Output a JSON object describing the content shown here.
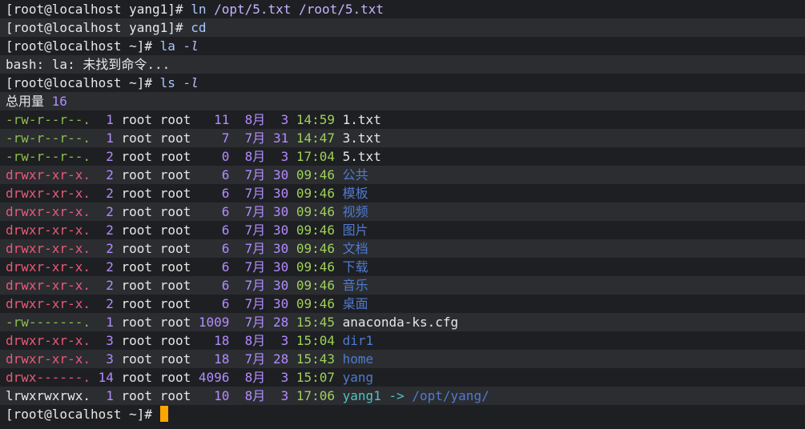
{
  "lines": [
    {
      "type": "cmd",
      "prompt": "[root@localhost yang1]#",
      "cmd": "ln",
      "args": " /opt/5.txt /root/5.txt",
      "flag": ""
    },
    {
      "type": "cmd",
      "prompt": "[root@localhost yang1]#",
      "cmd": "cd",
      "args": "",
      "flag": ""
    },
    {
      "type": "cmd",
      "prompt": "[root@localhost ~]#",
      "cmd": "la",
      "args": "",
      "flag": " -l"
    },
    {
      "type": "out",
      "text": "bash: la: 未找到命令..."
    },
    {
      "type": "cmd",
      "prompt": "[root@localhost ~]#",
      "cmd": "ls",
      "args": "",
      "flag": " -l"
    },
    {
      "type": "total",
      "label": "总用量",
      "value": "16"
    }
  ],
  "entries": [
    {
      "perm": "-rw-r--r--.",
      "links": "1",
      "owner": "root",
      "group": "root",
      "size": "11",
      "month": "8月",
      "day": "3",
      "time": "14:59",
      "name": "1.txt",
      "kind": "file"
    },
    {
      "perm": "-rw-r--r--.",
      "links": "1",
      "owner": "root",
      "group": "root",
      "size": "7",
      "month": "7月",
      "day": "31",
      "time": "14:47",
      "name": "3.txt",
      "kind": "file"
    },
    {
      "perm": "-rw-r--r--.",
      "links": "2",
      "owner": "root",
      "group": "root",
      "size": "0",
      "month": "8月",
      "day": "3",
      "time": "17:04",
      "name": "5.txt",
      "kind": "file"
    },
    {
      "perm": "drwxr-xr-x.",
      "links": "2",
      "owner": "root",
      "group": "root",
      "size": "6",
      "month": "7月",
      "day": "30",
      "time": "09:46",
      "name": "公共",
      "kind": "dir"
    },
    {
      "perm": "drwxr-xr-x.",
      "links": "2",
      "owner": "root",
      "group": "root",
      "size": "6",
      "month": "7月",
      "day": "30",
      "time": "09:46",
      "name": "模板",
      "kind": "dir"
    },
    {
      "perm": "drwxr-xr-x.",
      "links": "2",
      "owner": "root",
      "group": "root",
      "size": "6",
      "month": "7月",
      "day": "30",
      "time": "09:46",
      "name": "视频",
      "kind": "dir"
    },
    {
      "perm": "drwxr-xr-x.",
      "links": "2",
      "owner": "root",
      "group": "root",
      "size": "6",
      "month": "7月",
      "day": "30",
      "time": "09:46",
      "name": "图片",
      "kind": "dir"
    },
    {
      "perm": "drwxr-xr-x.",
      "links": "2",
      "owner": "root",
      "group": "root",
      "size": "6",
      "month": "7月",
      "day": "30",
      "time": "09:46",
      "name": "文档",
      "kind": "dir"
    },
    {
      "perm": "drwxr-xr-x.",
      "links": "2",
      "owner": "root",
      "group": "root",
      "size": "6",
      "month": "7月",
      "day": "30",
      "time": "09:46",
      "name": "下载",
      "kind": "dir"
    },
    {
      "perm": "drwxr-xr-x.",
      "links": "2",
      "owner": "root",
      "group": "root",
      "size": "6",
      "month": "7月",
      "day": "30",
      "time": "09:46",
      "name": "音乐",
      "kind": "dir"
    },
    {
      "perm": "drwxr-xr-x.",
      "links": "2",
      "owner": "root",
      "group": "root",
      "size": "6",
      "month": "7月",
      "day": "30",
      "time": "09:46",
      "name": "桌面",
      "kind": "dir"
    },
    {
      "perm": "-rw-------.",
      "links": "1",
      "owner": "root",
      "group": "root",
      "size": "1009",
      "month": "7月",
      "day": "28",
      "time": "15:45",
      "name": "anaconda-ks.cfg",
      "kind": "file"
    },
    {
      "perm": "drwxr-xr-x.",
      "links": "3",
      "owner": "root",
      "group": "root",
      "size": "18",
      "month": "8月",
      "day": "3",
      "time": "15:04",
      "name": "dir1",
      "kind": "dir"
    },
    {
      "perm": "drwxr-xr-x.",
      "links": "3",
      "owner": "root",
      "group": "root",
      "size": "18",
      "month": "7月",
      "day": "28",
      "time": "15:43",
      "name": "home",
      "kind": "dir"
    },
    {
      "perm": "drwx------.",
      "links": "14",
      "owner": "root",
      "group": "root",
      "size": "4096",
      "month": "8月",
      "day": "3",
      "time": "15:07",
      "name": "yang",
      "kind": "dir"
    },
    {
      "perm": "lrwxrwxrwx.",
      "links": "1",
      "owner": "root",
      "group": "root",
      "size": "10",
      "month": "8月",
      "day": "3",
      "time": "17:06",
      "name": "yang1",
      "kind": "link",
      "arrow": "->",
      "target": "/opt/yang/"
    }
  ],
  "final_prompt": "[root@localhost ~]#",
  "colors": {
    "background": "#1e1f22",
    "highlight": "#2b2d31",
    "cursor": "#ffa500",
    "dir": "#4f7bd0",
    "link": "#4fc3c3",
    "time": "#9ed05b"
  }
}
